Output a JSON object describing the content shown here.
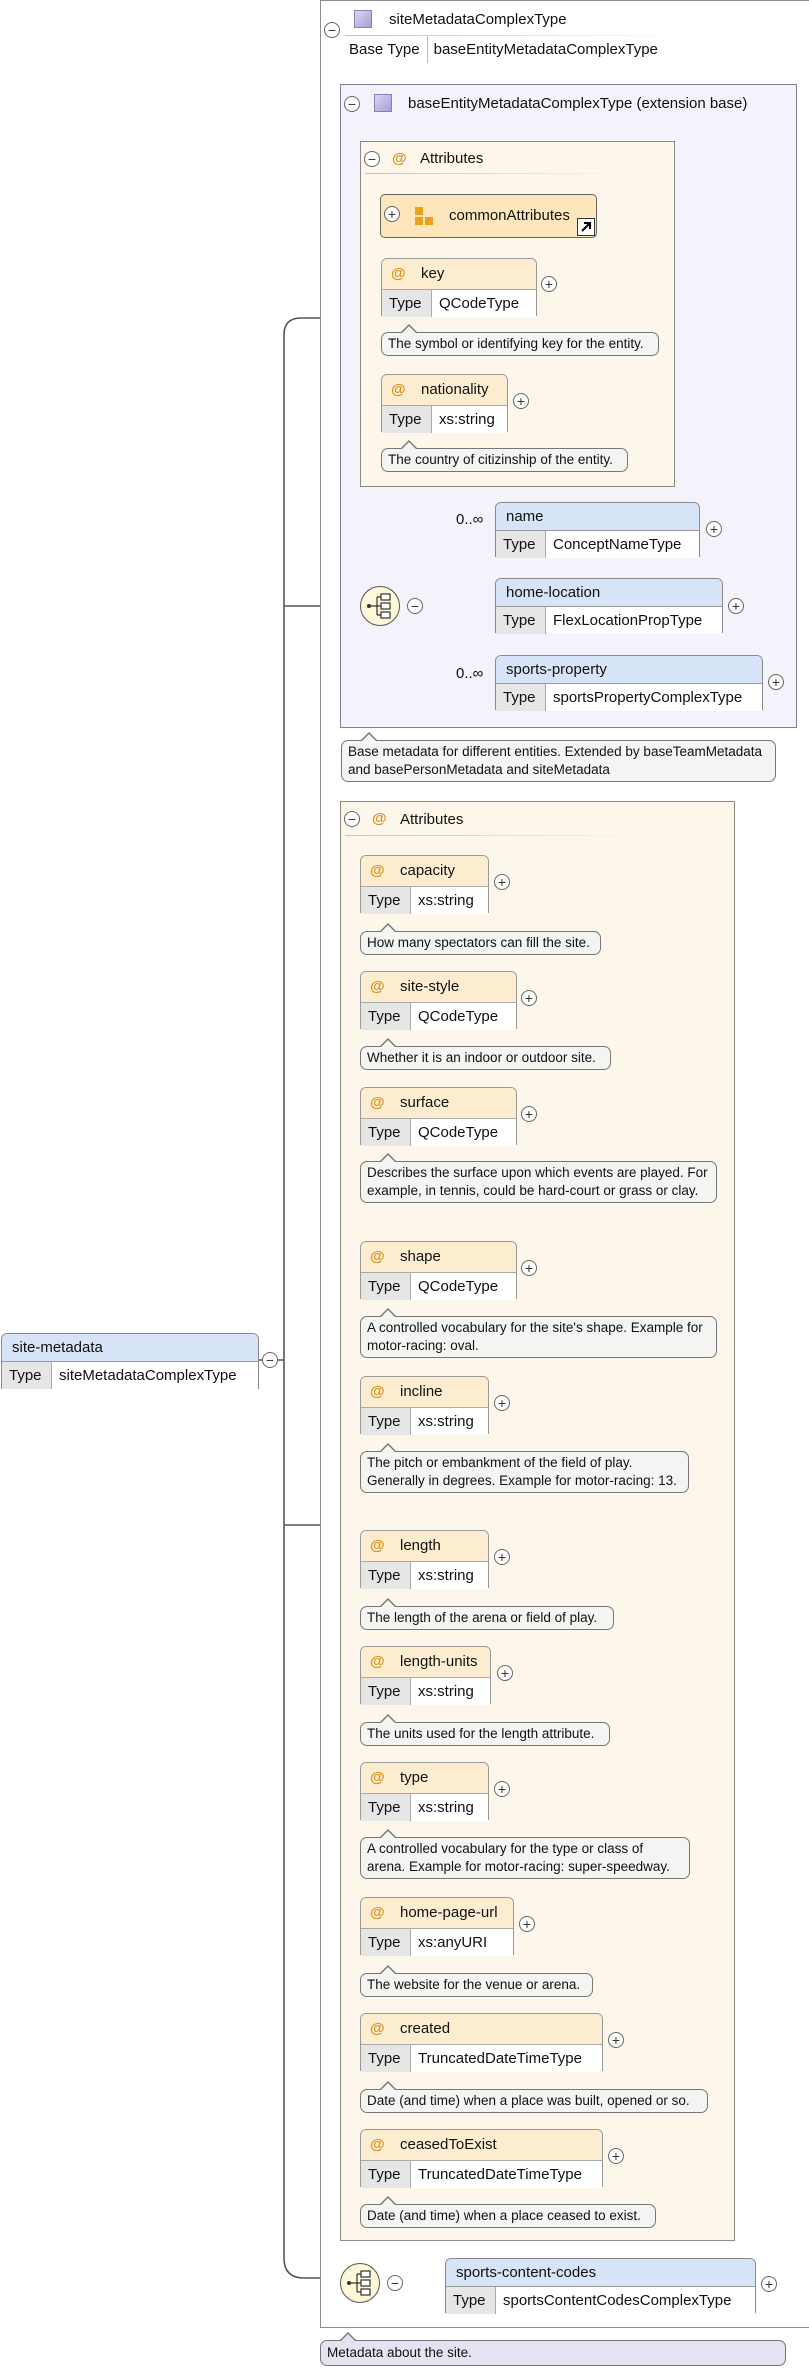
{
  "root": {
    "name": "site-metadata",
    "type_key": "Type",
    "type_value": "siteMetadataComplexType",
    "doc": "Metadata about the site."
  },
  "complex_type": {
    "name": "siteMetadataComplexType",
    "base_key": "Base Type",
    "base_value": "baseEntityMetadataComplexType"
  },
  "extension": {
    "title": "baseEntityMetadataComplexType (extension base)",
    "doc": "Base metadata for different entities. Extended by baseTeamMetadata and basePersonMetadata and siteMetadata",
    "attributes_title": "Attributes",
    "attribute_group": "commonAttributes",
    "attributes": [
      {
        "name": "key",
        "type_key": "Type",
        "type": "QCodeType",
        "doc": "The symbol or identifying key for the entity."
      },
      {
        "name": "nationality",
        "type_key": "Type",
        "type": "xs:string",
        "doc": "The country of citizinship of the entity."
      }
    ],
    "elements": [
      {
        "name": "name",
        "type_key": "Type",
        "type": "ConceptNameType",
        "occurs": "0..∞"
      },
      {
        "name": "home-location",
        "type_key": "Type",
        "type": "FlexLocationPropType",
        "occurs": ""
      },
      {
        "name": "sports-property",
        "type_key": "Type",
        "type": "sportsPropertyComplexType",
        "occurs": "0..∞"
      }
    ]
  },
  "attributes": {
    "title": "Attributes",
    "items": [
      {
        "name": "capacity",
        "type_key": "Type",
        "type": "xs:string",
        "doc": "How many spectators can fill the site."
      },
      {
        "name": "site-style",
        "type_key": "Type",
        "type": "QCodeType",
        "doc": "Whether it is an indoor or outdoor site."
      },
      {
        "name": "surface",
        "type_key": "Type",
        "type": "QCodeType",
        "doc": "Describes the surface upon which events are played. For example, in tennis, could be hard-court or grass or clay."
      },
      {
        "name": "shape",
        "type_key": "Type",
        "type": "QCodeType",
        "doc": "A controlled vocabulary for the site's shape. Example for motor-racing: oval."
      },
      {
        "name": "incline",
        "type_key": "Type",
        "type": "xs:string",
        "doc": "The pitch or embankment of the field of play. Generally in degrees. Example for motor-racing: 13."
      },
      {
        "name": "length",
        "type_key": "Type",
        "type": "xs:string",
        "doc": "The length of the arena or field of play."
      },
      {
        "name": "length-units",
        "type_key": "Type",
        "type": "xs:string",
        "doc": "The units used for the length attribute."
      },
      {
        "name": "type",
        "type_key": "Type",
        "type": "xs:string",
        "doc": "A controlled vocabulary for the type or class of arena. Example for motor-racing: super-speedway."
      },
      {
        "name": "home-page-url",
        "type_key": "Type",
        "type": "xs:anyURI",
        "doc": "The website for the venue or arena."
      },
      {
        "name": "created",
        "type_key": "Type",
        "type": "TruncatedDateTimeType",
        "doc": "Date (and time) when a place was built, opened or so."
      },
      {
        "name": "ceasedToExist",
        "type_key": "Type",
        "type": "TruncatedDateTimeType",
        "doc": "Date (and time) when a place ceased to exist."
      }
    ]
  },
  "content_element": {
    "name": "sports-content-codes",
    "type_key": "Type",
    "type": "sportsContentCodesComplexType"
  },
  "symbols": {
    "collapse": "−",
    "expand": "+",
    "attribute": "@"
  },
  "colors": {
    "element_header": "#d7e3f6",
    "attribute_header": "#fdedd0",
    "attribute_group_bg": "#fdf6ea",
    "extension_bg": "#f4f2fa",
    "at_sign": "#d9911c"
  }
}
